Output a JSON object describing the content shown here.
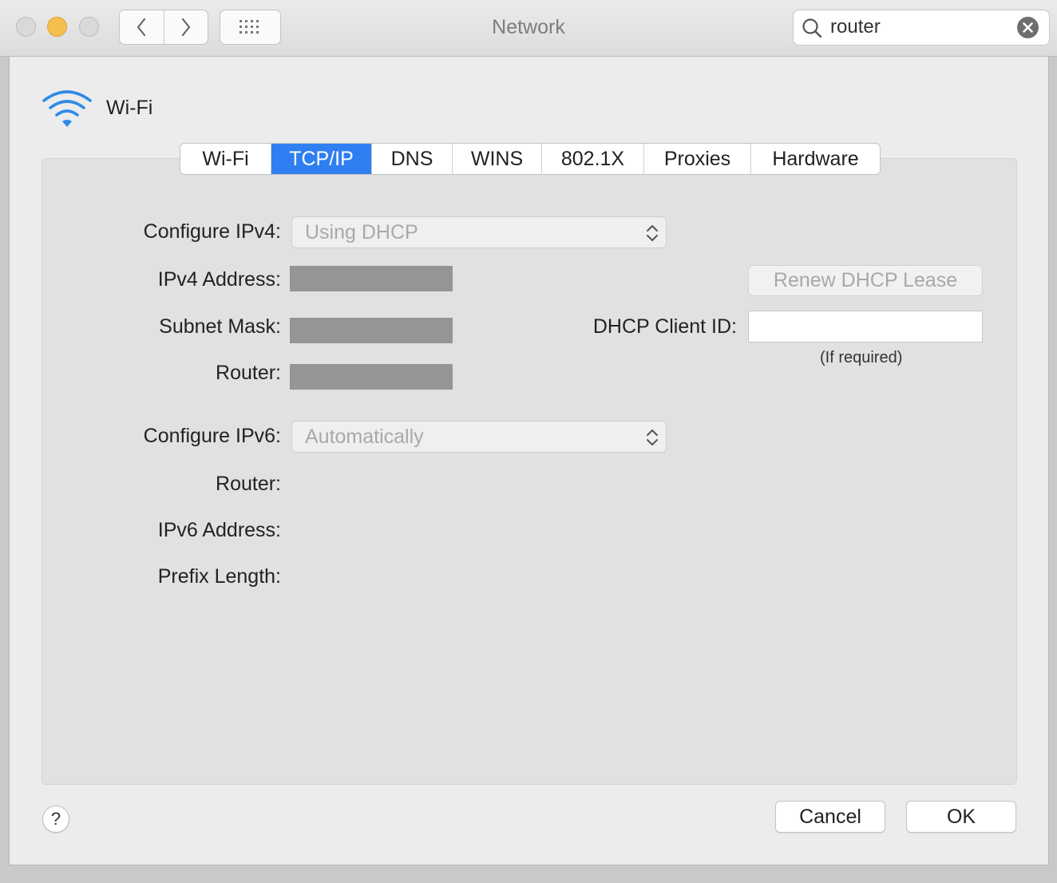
{
  "window": {
    "title": "Network",
    "search": {
      "value": "router",
      "placeholder": "Search"
    }
  },
  "service": {
    "name": "Wi-Fi"
  },
  "tabs": [
    {
      "label": "Wi-Fi"
    },
    {
      "label": "TCP/IP",
      "active": true
    },
    {
      "label": "DNS"
    },
    {
      "label": "WINS"
    },
    {
      "label": "802.1X"
    },
    {
      "label": "Proxies"
    },
    {
      "label": "Hardware"
    }
  ],
  "ipv4": {
    "configure_label": "Configure IPv4:",
    "configure_value": "Using DHCP",
    "address_label": "IPv4 Address:",
    "subnet_label": "Subnet Mask:",
    "router_label": "Router:"
  },
  "dhcp": {
    "renew_label": "Renew DHCP Lease",
    "client_id_label": "DHCP Client ID:",
    "client_id_value": "",
    "client_id_hint": "(If required)"
  },
  "ipv6": {
    "configure_label": "Configure IPv6:",
    "configure_value": "Automatically",
    "router_label": "Router:",
    "address_label": "IPv6 Address:",
    "prefix_label": "Prefix Length:"
  },
  "footer": {
    "help_label": "?",
    "cancel_label": "Cancel",
    "ok_label": "OK"
  },
  "colors": {
    "accent": "#2f7ff2",
    "redacted": "#959595",
    "minimize": "#f5bf4f"
  }
}
